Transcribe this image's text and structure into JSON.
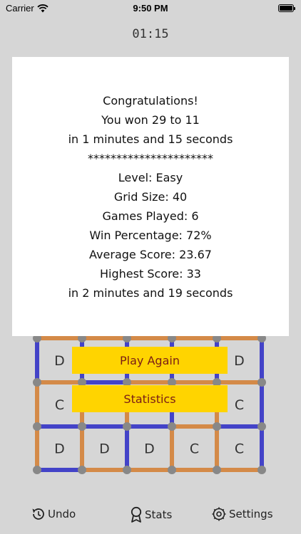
{
  "status_bar": {
    "carrier": "Carrier",
    "time": "9:50 PM"
  },
  "timer": "01:15",
  "colors": {
    "player": "#4343c8",
    "opponent": "#d48a48",
    "dot": "#888888",
    "button": "#ffd400",
    "button_text": "#7a1d16"
  },
  "board": {
    "cols": 5,
    "rows": 3,
    "boxes": [
      [
        "D",
        "",
        "",
        "",
        "D"
      ],
      [
        "C",
        "",
        "",
        "",
        "C"
      ],
      [
        "D",
        "D",
        "D",
        "C",
        "C"
      ]
    ],
    "h_edges": [
      [
        "opponent",
        "opponent",
        "opponent",
        "opponent",
        "opponent"
      ],
      [
        "opponent",
        "player",
        "opponent",
        "opponent",
        "opponent"
      ],
      [
        "player",
        "player",
        "player",
        "opponent",
        "player"
      ],
      [
        "player",
        "opponent",
        "opponent",
        "opponent",
        "opponent"
      ]
    ],
    "v_edges": [
      [
        "player",
        "player",
        "player",
        "player",
        "player",
        "player"
      ],
      [
        "opponent",
        "opponent",
        "opponent",
        "player",
        "opponent",
        "player"
      ],
      [
        "opponent",
        "opponent",
        "player",
        "opponent",
        "opponent",
        "player"
      ]
    ]
  },
  "modal": {
    "lines": [
      "Congratulations!",
      "You won 29 to 11",
      "in 1 minutes and 15 seconds",
      "**********************",
      "Level: Easy",
      "Grid Size: 40",
      "Games Played: 6",
      "Win Percentage: 72%",
      "Average Score: 23.67",
      "Highest Score: 33",
      "in 2 minutes and 19 seconds"
    ],
    "play_again": "Play Again",
    "statistics": "Statistics"
  },
  "toolbar": {
    "undo": "Undo",
    "stats": "Stats",
    "settings": "Settings"
  }
}
